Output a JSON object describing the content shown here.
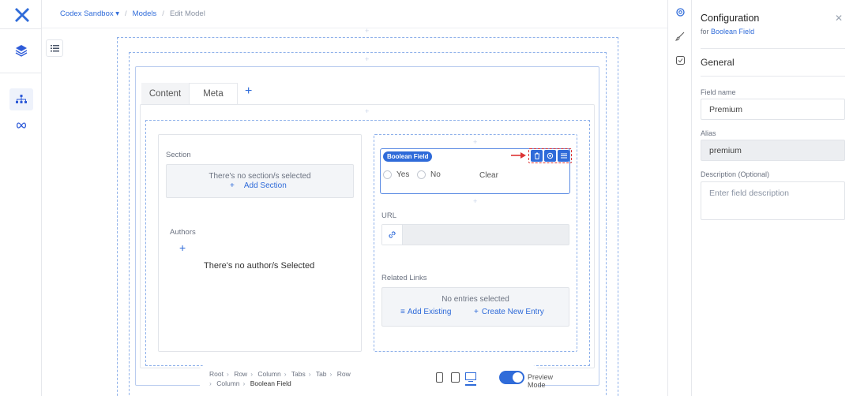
{
  "breadcrumb": {
    "workspace": "Codex Sandbox",
    "workspace_caret": "▾",
    "separator": "/",
    "models": "Models",
    "current": "Edit Model"
  },
  "rail": {
    "icons": [
      "logo-icon",
      "layers-icon",
      "hierarchy-icon",
      "infinity-icon"
    ]
  },
  "tabs": [
    {
      "label": "Content",
      "active": false
    },
    {
      "label": "Meta",
      "active": true
    }
  ],
  "tab_add": "+",
  "left_column": {
    "section_label": "Section",
    "section_empty": "There's no section/s selected",
    "section_add": "Add Section",
    "authors_label": "Authors",
    "authors_add": "+",
    "authors_empty": "There's no author/s Selected"
  },
  "right_column": {
    "bool_tag": "Boolean Field",
    "yes_label": "Yes",
    "no_label": "No",
    "clear_label": "Clear",
    "url_label": "URL",
    "related_label": "Related Links",
    "related_empty": "No entries selected",
    "add_existing": "Add Existing",
    "create_new": "Create New Entry"
  },
  "bottom_bar": {
    "path": [
      "Root",
      "Row",
      "Column",
      "Tabs",
      "Tab",
      "Row",
      "Column"
    ],
    "current": "Boolean Field",
    "preview_label": "Preview Mode",
    "preview_on": true
  },
  "config": {
    "title": "Configuration",
    "sub_prefix": "for",
    "sub_link": "Boolean Field",
    "section": "General",
    "field_name_label": "Field name",
    "field_name_value": "Premium",
    "alias_label": "Alias",
    "alias_value": "premium",
    "description_label": "Description (Optional)",
    "description_placeholder": "Enter field description"
  },
  "colors": {
    "accent": "#2f6bd9",
    "dashed": "#8fb1ea",
    "danger": "#dd3333"
  }
}
